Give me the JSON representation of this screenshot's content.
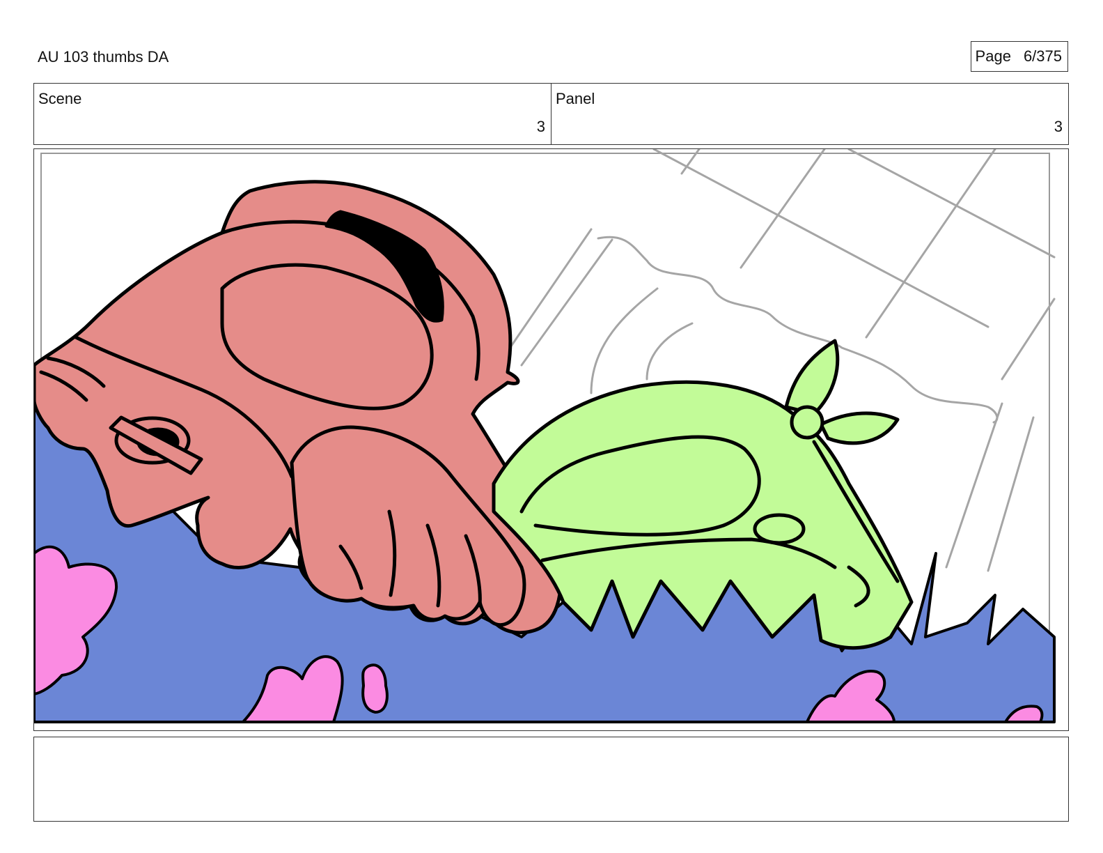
{
  "header": {
    "document_title": "AU 103 thumbs DA",
    "page_label": "Page",
    "page_value": "6/375"
  },
  "info": {
    "scene_label": "Scene",
    "scene_value": "3",
    "panel_label": "Panel",
    "panel_value": "3"
  },
  "illustration": {
    "colors": {
      "ground": "#6B86D6",
      "red_character": "#E58C89",
      "green_character": "#C2FB98",
      "flowers": "#FB8BE2",
      "sketch": "#A5A5A5",
      "ink": "#000000"
    }
  },
  "notes": {
    "text": ""
  }
}
